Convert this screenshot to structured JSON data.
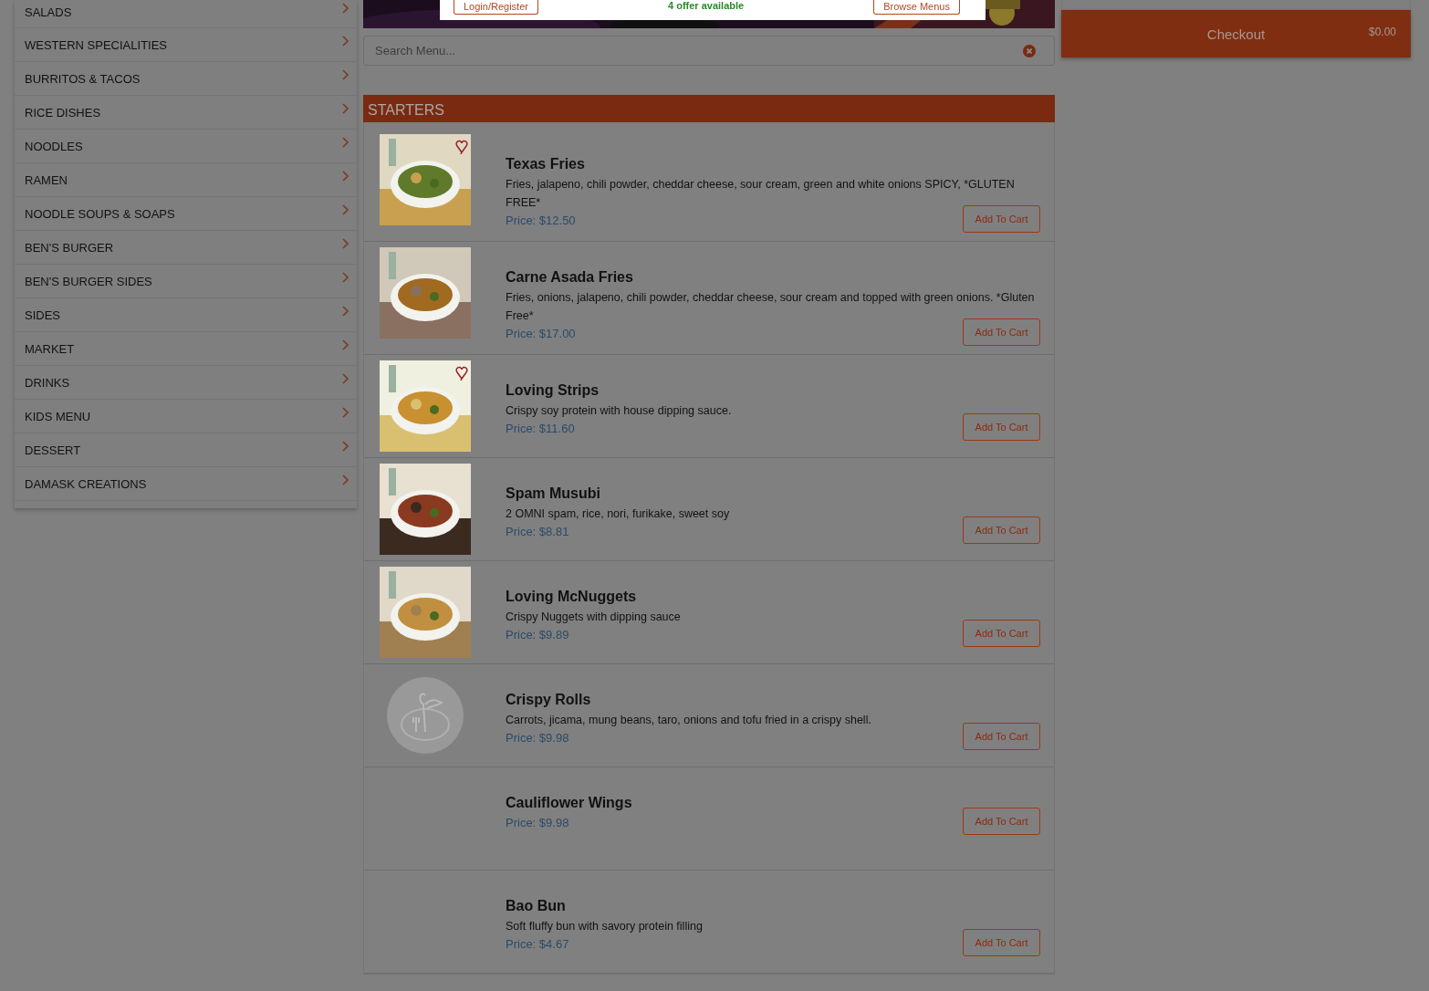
{
  "categories": [
    {
      "label": "SALADS"
    },
    {
      "label": "WESTERN SPECIALITIES"
    },
    {
      "label": "BURRITOS & TACOS"
    },
    {
      "label": "RICE DISHES"
    },
    {
      "label": "NOODLES"
    },
    {
      "label": "RAMEN"
    },
    {
      "label": "NOODLE SOUPS & SOAPS"
    },
    {
      "label": "BEN'S BURGER"
    },
    {
      "label": "BEN'S BURGER SIDES"
    },
    {
      "label": "SIDES"
    },
    {
      "label": "MARKET"
    },
    {
      "label": "DRINKS"
    },
    {
      "label": "KIDS MENU"
    },
    {
      "label": "DESSERT"
    },
    {
      "label": "DAMASK CREATIONS"
    }
  ],
  "modal": {
    "login": "Login/Register",
    "offer": "4 offer available",
    "browse": "Browse Menus"
  },
  "search": {
    "placeholder": "Search Menu..."
  },
  "section": {
    "title": "STARTERS"
  },
  "items": [
    {
      "name": "Texas Fries",
      "description": "Fries, jalapeno, chili powder, cheddar cheese, sour cream, green and white onions SPICY, *GLUTEN FREE*",
      "price": "Price: $12.50",
      "heart": true,
      "button": "Add To Cart"
    },
    {
      "name": "Carne Asada Fries",
      "description": "Fries, onions, jalapeno, chili powder, cheddar cheese, sour cream and topped with green onions. *Gluten Free*",
      "price": "Price: $17.00",
      "heart": false,
      "button": "Add To Cart"
    },
    {
      "name": "Loving Strips",
      "description": "Crispy soy protein with house dipping sauce.",
      "price": "Price: $11.60",
      "heart": true,
      "button": "Add To Cart"
    },
    {
      "name": "Spam Musubi",
      "description": "2 OMNI spam, rice, nori, furikake, sweet soy",
      "price": "Price: $8.81",
      "heart": false,
      "button": "Add To Cart"
    },
    {
      "name": "Loving McNuggets",
      "description": "Crispy Nuggets with dipping sauce",
      "price": "Price: $9.89",
      "heart": false,
      "button": "Add To Cart"
    },
    {
      "name": "Crispy Rolls",
      "description": "Carrots, jicama, mung beans, taro, onions and tofu fried in a crispy shell.",
      "price": "Price: $9.98",
      "kind": "placeholder",
      "heart": false,
      "button": "Add To Cart"
    },
    {
      "name": "Cauliflower Wings",
      "price": "Price: $9.98",
      "kind": "plain",
      "heart": false,
      "button": "Add To Cart"
    },
    {
      "name": "Bao Bun",
      "description": "Soft fluffy bun with savory protein filling",
      "price": "Price: $4.67",
      "kind": "plain",
      "heart": false,
      "button": "Add To Cart"
    }
  ],
  "checkout": {
    "label": "Checkout",
    "total": "$0.00"
  }
}
